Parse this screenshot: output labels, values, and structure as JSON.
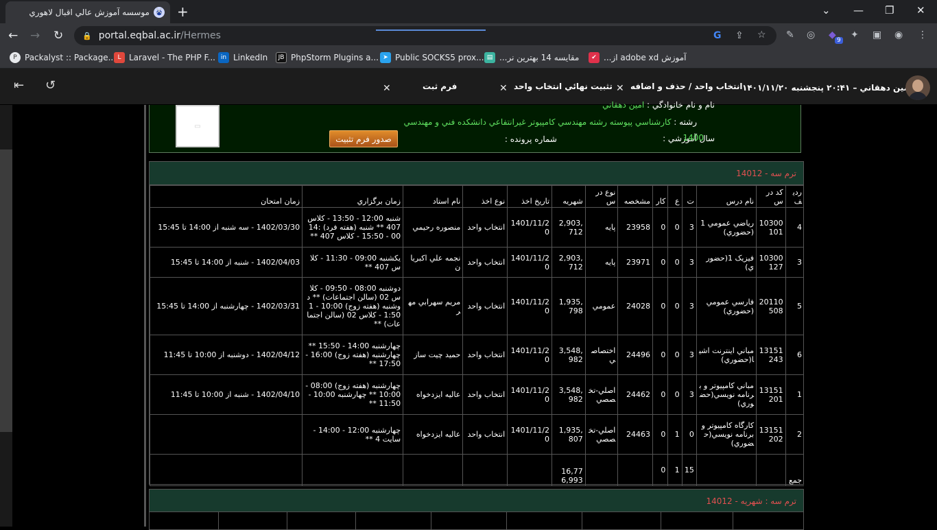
{
  "browser": {
    "tab_title": "موسسه آموزش عالي اقبال لاهوري",
    "url_host": "portal.eqbal.ac.ir",
    "url_path": "/Hermes",
    "extensions_badge": "9",
    "bookmarks": [
      {
        "label": "Packalyst :: Package...",
        "color": "#e8eaed"
      },
      {
        "label": "Laravel - The PHP F...",
        "color": "#e0483c"
      },
      {
        "label": "LinkedIn",
        "color": "#0a66c2"
      },
      {
        "label": "PhpStorm Plugins a...",
        "color": "#111111"
      },
      {
        "label": "Public SOCKS5 prox...",
        "color": "#2aa3ef"
      },
      {
        "label": "مقایسه 14 بهترین نر...",
        "color": "#3cb4a0"
      },
      {
        "label": "آموزش adobe xd از...",
        "color": "#e0314b"
      }
    ]
  },
  "app": {
    "user_line": "امين دهقاني – ۲۰:۴۱ پنجشنبه ۱۴۰۱/۱۱/۲۰",
    "tabs": [
      {
        "label": "انتخاب واحد / حذف و اضافه"
      },
      {
        "label": "تثبيت نهائي انتخاب واحد"
      },
      {
        "label": "فرم ثبت"
      }
    ]
  },
  "student": {
    "name_label": "نام و نام خانوادگي :",
    "name_value": "امين دهقاني",
    "major_label": "رشته :",
    "major_value": "کارشناسي پيوسته رشته مهندسي کامپيوتر غيرانتفاعي دانشکده فني و مهندسي",
    "year_label": "سال آموزشي :",
    "year_value": "1400",
    "file_label": "شماره پرونده :",
    "issue_button": "صدور فرم تثبيت"
  },
  "term": {
    "title": "ترم سه - 14012",
    "columns": [
      "رديف",
      "کد درس",
      "نام درس",
      "ت",
      "ع",
      "کار",
      "مشخصه",
      "نوع درس",
      "شهريه",
      "تاريخ اخذ",
      "نوع اخذ",
      "نام استاد",
      "زمان برگزاري",
      "زمان امتحان"
    ],
    "rows": [
      [
        "4",
        "10300101",
        "رياضي عمومي 1 (حضوري)",
        "3",
        "0",
        "0",
        "23958",
        "پايه",
        "2,903,712",
        "1401/11/20",
        "انتخاب واحد",
        "منصوره رحيمي",
        "شنبه 12:00 - 13:50 - کلاس 407 ** شنبه (هفته فرد) 14:00 - 15:50 - کلاس 407 **",
        "1402/03/30 - سه شنبه از 14:00 تا 15:45"
      ],
      [
        "3",
        "10300127",
        "فيزيک 1(حضوري)",
        "3",
        "0",
        "0",
        "23971",
        "پايه",
        "2,903,712",
        "1401/11/20",
        "انتخاب واحد",
        "نجمه علي اکبريان",
        "يکشنبه 09:00 - 11:30 - کلاس 407 **",
        "1402/04/03 - شنبه از 14:00 تا 15:45"
      ],
      [
        "5",
        "20110508",
        "فارسي عمومي (حضوري)",
        "3",
        "0",
        "0",
        "24028",
        "عمومي",
        "1,935,798",
        "1401/11/20",
        "انتخاب واحد",
        "مريم سهرابي مهر",
        "دوشنبه 08:00 - 09:50 - کلاس 02 (سالن اجتماعات) ** دوشنبه (هفته زوج) 10:00 - 11:50 - کلاس 02 (سالن اجتماعات) **",
        "1402/03/31 - چهارشنبه از 14:00 تا 15:45"
      ],
      [
        "6",
        "13151243",
        "مباني اينترنت اشيا(حضوري)",
        "3",
        "0",
        "0",
        "24496",
        "اختصاصي",
        "3,548,982",
        "1401/11/20",
        "انتخاب واحد",
        "حميد چيت ساز",
        "چهارشنبه 14:00 - 15:50 ** چهارشنبه (هفته زوج) 16:00 - 17:50 **",
        "1402/04/12 - دوشنبه از 10:00 تا 11:45"
      ],
      [
        "1",
        "13151201",
        "مباني کامپيوتر و برنامه نويسي(حضوري)",
        "3",
        "0",
        "0",
        "24462",
        "اصلي-تخصصي",
        "3,548,982",
        "1401/11/20",
        "انتخاب واحد",
        "عاليه ايزدخواه",
        "چهارشنبه (هفته زوج) 08:00 - 10:00 ** چهارشنبه 10:00 - 11:50 **",
        "1402/04/10 - شنبه از 10:00 تا 11:45"
      ],
      [
        "2",
        "13151202",
        "کارگاه کامپيوتر و برنامه نويسي(حضوري)",
        "0",
        "1",
        "0",
        "24463",
        "اصلي-تخصصي",
        "1,935,807",
        "1401/11/20",
        "انتخاب واحد",
        "عاليه ايزدخواه",
        "چهارشنبه 12:00 - 14:00 - سايت 4 **",
        ""
      ]
    ],
    "total_label": "جمع",
    "total_t": "15",
    "total_a": "1",
    "total_k": "0",
    "total_fee": "16,776,993"
  },
  "term2": {
    "title": "ترم سه : شهريه - 14012"
  }
}
